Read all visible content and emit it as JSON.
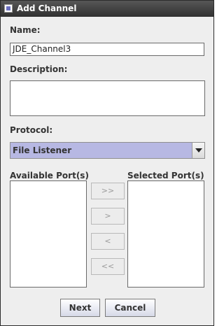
{
  "window": {
    "title": "Add Channel"
  },
  "form": {
    "name_label": "Name:",
    "name_value": "JDE_Channel3",
    "description_label": "Description:",
    "description_value": "",
    "protocol_label": "Protocol:",
    "protocol_value": "File Listener"
  },
  "ports": {
    "available_label": "Available Port(s)",
    "selected_label": "Selected Port(s)",
    "available_items": [],
    "selected_items": [],
    "buttons": {
      "add_all": ">>",
      "add": ">",
      "remove": "<",
      "remove_all": "<<"
    }
  },
  "actions": {
    "next": "Next",
    "cancel": "Cancel"
  },
  "colors": {
    "combo_selection": "#b7b8e3",
    "titlebar": "#3c3c3c"
  }
}
